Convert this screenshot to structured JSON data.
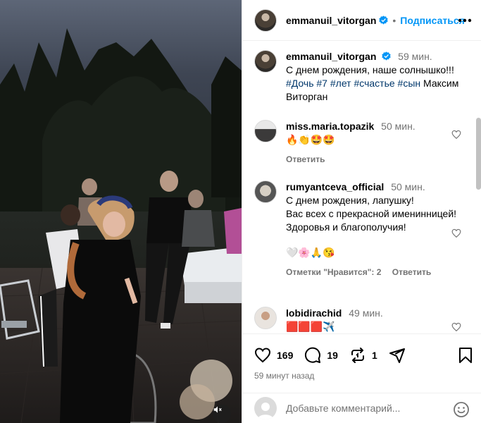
{
  "post": {
    "username": "emmanuil_vitorgan",
    "follow_label": "Подписаться",
    "caption_time": "59 мин.",
    "caption_text": "С днем рождения, наше солнышко!!!",
    "hashtags": [
      "#Дочь",
      "#7",
      "#лет",
      "#счастье",
      "#сын"
    ],
    "caption_tail": "Максим Виторган"
  },
  "comments": [
    {
      "username": "miss.maria.topazik",
      "time": "50 мин.",
      "text": "🔥👏🤩🤩",
      "reply_label": "Ответить"
    },
    {
      "username": "rumyantceva_official",
      "time": "50 мин.",
      "lines": [
        "С днем рождения, лапушку!",
        "Вас всех с прекрасной именинницей!",
        "Здоровья и благополучия!"
      ],
      "emoji_line": "🤍🌸🙏😘",
      "likes_label": "Отметки \"Нравится\": 2",
      "reply_label": "Ответить"
    },
    {
      "username": "lobidirachid",
      "time": "49 мин.",
      "text": "🟥🟥🟥✈️"
    }
  ],
  "actions": {
    "likes_count": "169",
    "comments_count": "19",
    "reposts_count": "1",
    "posted_ago": "59 минут назад"
  },
  "add_comment": {
    "placeholder": "Добавьте комментарий..."
  },
  "icons": {
    "verified": "verified-badge-icon",
    "more": "more-horizontal-icon",
    "heart": "heart-icon",
    "comment": "comment-bubble-icon",
    "repost": "repost-icon",
    "share": "send-plane-icon",
    "bookmark": "bookmark-icon",
    "emoji": "emoji-smile-icon",
    "mute": "speaker-muted-icon"
  },
  "colors": {
    "accent": "#0095f6",
    "verified": "#0095f6",
    "hashtag": "#00376b",
    "secondary_text": "#737373",
    "divider": "#efefef"
  }
}
